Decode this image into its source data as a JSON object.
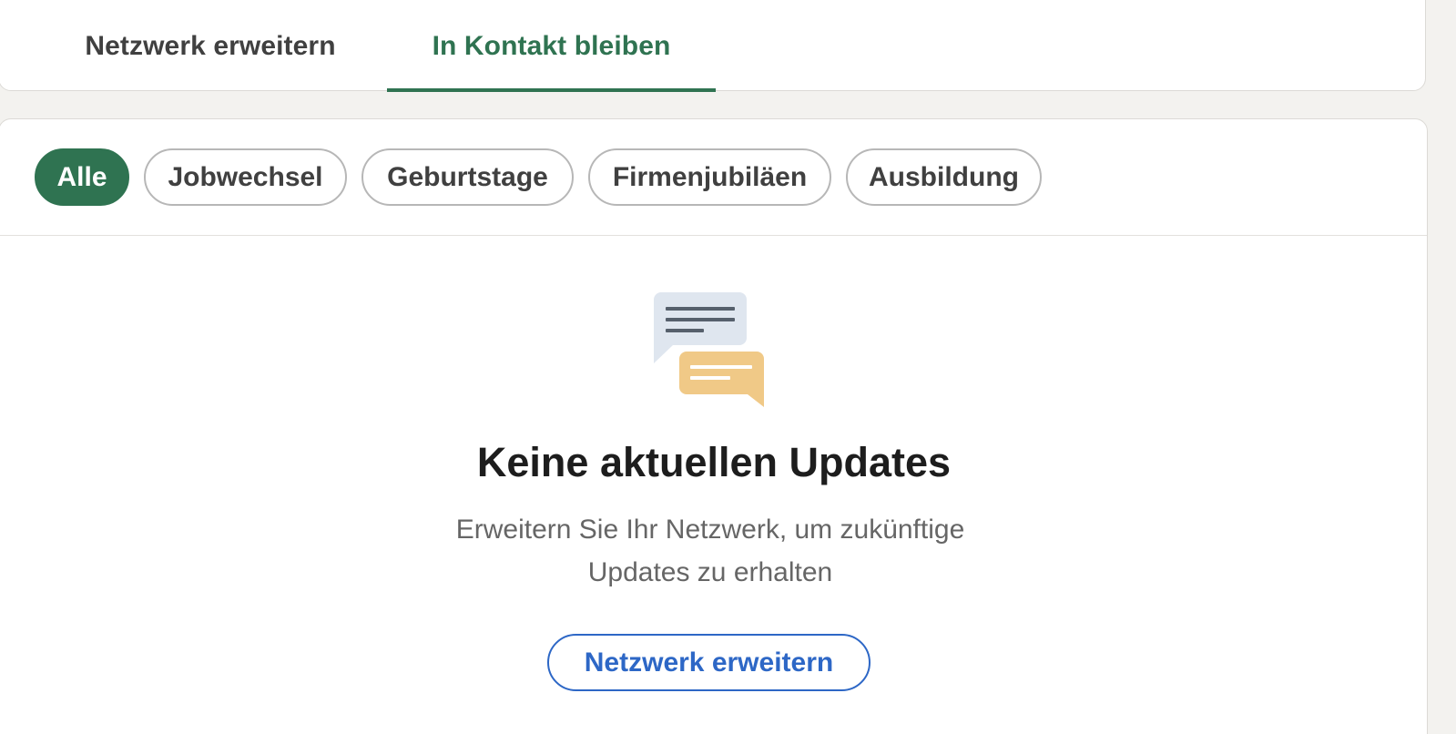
{
  "tabs": [
    {
      "label": "Netzwerk erweitern",
      "active": false
    },
    {
      "label": "In Kontakt bleiben",
      "active": true
    }
  ],
  "filters": [
    {
      "label": "Alle",
      "active": true
    },
    {
      "label": "Jobwechsel",
      "active": false
    },
    {
      "label": "Geburtstage",
      "active": false
    },
    {
      "label": "Firmenjubiläen",
      "active": false
    },
    {
      "label": "Ausbildung",
      "active": false
    }
  ],
  "empty_state": {
    "icon": "chat-bubbles-icon",
    "title": "Keine aktuellen Updates",
    "description_line1": "Erweitern Sie Ihr Netzwerk, um zukünftige",
    "description_line2": "Updates zu erhalten",
    "cta_label": "Netzwerk erweitern"
  },
  "colors": {
    "accent_green": "#2f7351",
    "link_blue": "#2d67c6",
    "background": "#f3f2ef"
  }
}
